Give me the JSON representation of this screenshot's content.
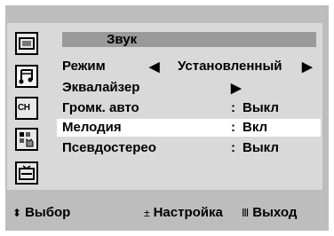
{
  "menu": {
    "title": "Звук",
    "rows": [
      {
        "label": "Режим",
        "left_arrow": "◀",
        "value": "Установленный",
        "right_arrow": "▶"
      },
      {
        "label": "Эквалайзер",
        "arrow": "▶"
      },
      {
        "label": "Громк. авто",
        "colon": ":",
        "value": "Выкл"
      },
      {
        "label": "Мелодия",
        "colon": ":",
        "value": "Вкл"
      },
      {
        "label": "Псевдостерео",
        "colon": ":",
        "value": "Выкл"
      }
    ],
    "selected_row": "Мелодия"
  },
  "sidebar": {
    "icons": [
      "picture-icon",
      "sound-icon",
      "channel-icon",
      "setup-icon",
      "input-icon"
    ],
    "channel_label": "CH",
    "active": "sound-icon"
  },
  "footer": {
    "select_symbol": "⬍",
    "select_label": "Выбор",
    "adjust_symbol": "±",
    "adjust_label": "Настройка",
    "exit_symbol": "Ⅲ",
    "exit_label": "Выход"
  },
  "colors": {
    "frame": "#bdbdbd",
    "panel": "#d9d9d9",
    "title_bar": "#9a9a9a",
    "highlight": "#ffffff"
  }
}
